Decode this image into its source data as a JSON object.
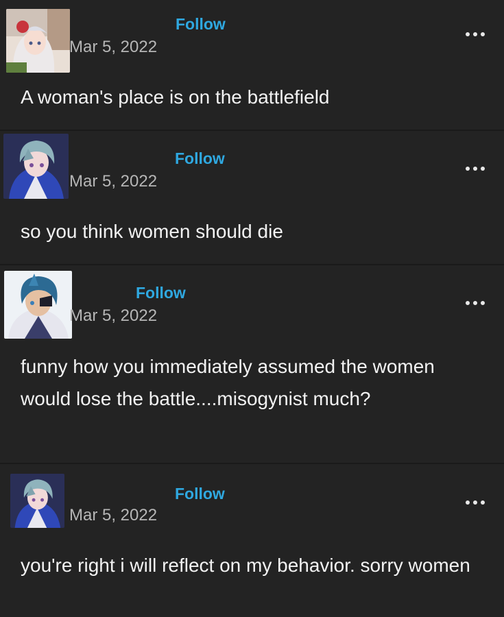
{
  "posts": [
    {
      "avatar": "noelle-avatar",
      "follow_label": "Follow",
      "date": "Mar 5, 2022",
      "more_icon": "ellipsis-icon",
      "text": "A woman's place is on the battlefield"
    },
    {
      "avatar": "scaramouche-avatar",
      "follow_label": "Follow",
      "date": "Mar 5, 2022",
      "more_icon": "ellipsis-icon",
      "text": "so you think women should die"
    },
    {
      "avatar": "kaeya-avatar",
      "follow_label": "Follow",
      "date": "Mar 5, 2022",
      "more_icon": "ellipsis-icon",
      "text": "funny how you immediately assumed the women would lose the battle....misogynist much?"
    },
    {
      "avatar": "scaramouche-avatar",
      "follow_label": "Follow",
      "date": "Mar 5, 2022",
      "more_icon": "ellipsis-icon",
      "text": "you're right i will reflect on my behavior. sorry women"
    }
  ],
  "colors": {
    "background": "#232323",
    "link": "#2fa8e0",
    "date": "#b6b6b6",
    "text": "#f2f2f2"
  }
}
